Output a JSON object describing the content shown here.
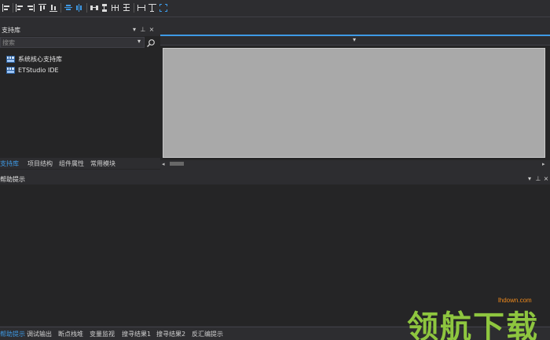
{
  "toolbar": {
    "buttons": [
      "align-left-icon",
      "align-center-h-icon",
      "align-right-icon",
      "align-top-icon",
      "align-bottom-icon",
      "center-horizontal-icon",
      "center-vertical-icon",
      "space-horizontal-icon",
      "space-vertical-icon",
      "equal-width-icon",
      "equal-height-icon",
      "same-size-icon",
      "fit-screen-icon"
    ]
  },
  "library_panel": {
    "title": "支持库",
    "search_placeholder": "搜索",
    "search_dropdown_arrow": "▾",
    "items": [
      {
        "label": "系统核心支持库",
        "icon": "library-icon"
      },
      {
        "label": "ETStudio IDE",
        "icon": "library-icon"
      }
    ],
    "controls": {
      "dropdown": "▾",
      "pin": "⊥",
      "close": "×"
    }
  },
  "left_tabs": [
    {
      "label": "支持库",
      "active": true
    },
    {
      "label": "项目结构",
      "active": false
    },
    {
      "label": "组件属性",
      "active": false
    },
    {
      "label": "常用模块",
      "active": false
    }
  ],
  "editor": {
    "dropdown_arrow": "▾",
    "scroll_left": "◂",
    "scroll_right": "▸",
    "accent": "#3e9ae6",
    "canvas_color": "#a9a9a9"
  },
  "output_panel": {
    "title": "帮助提示",
    "controls": {
      "dropdown": "▾",
      "pin": "⊥",
      "close": "×"
    }
  },
  "bottom_tabs": [
    {
      "label": "帮助提示",
      "active": true
    },
    {
      "label": "调试输出",
      "active": false
    },
    {
      "label": "断点栈堆",
      "active": false
    },
    {
      "label": "变量监视",
      "active": false
    },
    {
      "label": "搜寻结果1",
      "active": false
    },
    {
      "label": "搜寻结果2",
      "active": false
    },
    {
      "label": "反汇编提示",
      "active": false
    }
  ],
  "watermark": {
    "url": "lhdown.com",
    "text": "领航下载"
  }
}
